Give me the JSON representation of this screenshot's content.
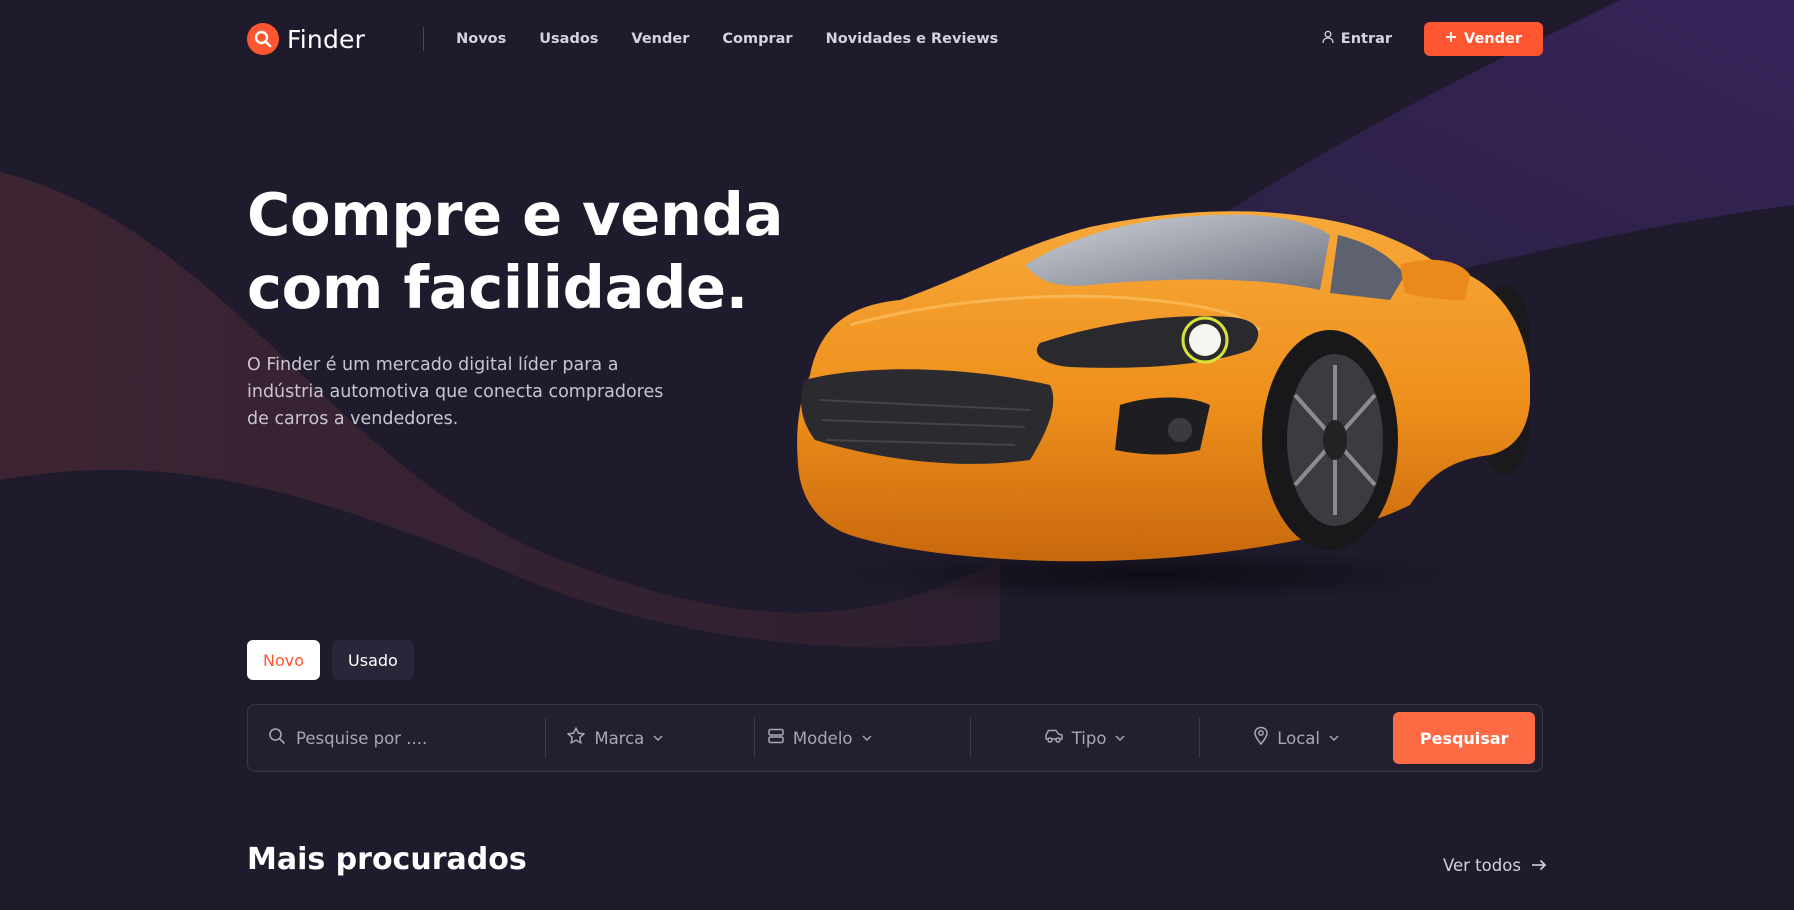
{
  "brand": {
    "name": "Finder",
    "logo_icon": "search-icon",
    "accent": "#fd5631"
  },
  "nav": {
    "items": [
      "Novos",
      "Usados",
      "Vender",
      "Comprar",
      "Novidades e Reviews"
    ],
    "signin_label": "Entrar",
    "sell_label": "Vender"
  },
  "hero": {
    "title_line1": "Compre e venda",
    "title_line2": "com facilidade.",
    "description": "O Finder é um mercado digital líder para a indústria automotiva que conecta compradores de carros a vendedores."
  },
  "tabs": {
    "active": "Novo",
    "inactive": "Usado"
  },
  "search": {
    "placeholder": "Pesquise por ....",
    "marca": "Marca",
    "modelo": "Modelo",
    "tipo": "Tipo",
    "local": "Local",
    "button": "Pesquisar"
  },
  "section": {
    "title": "Mais procurados",
    "view_all": "Ver todos"
  }
}
